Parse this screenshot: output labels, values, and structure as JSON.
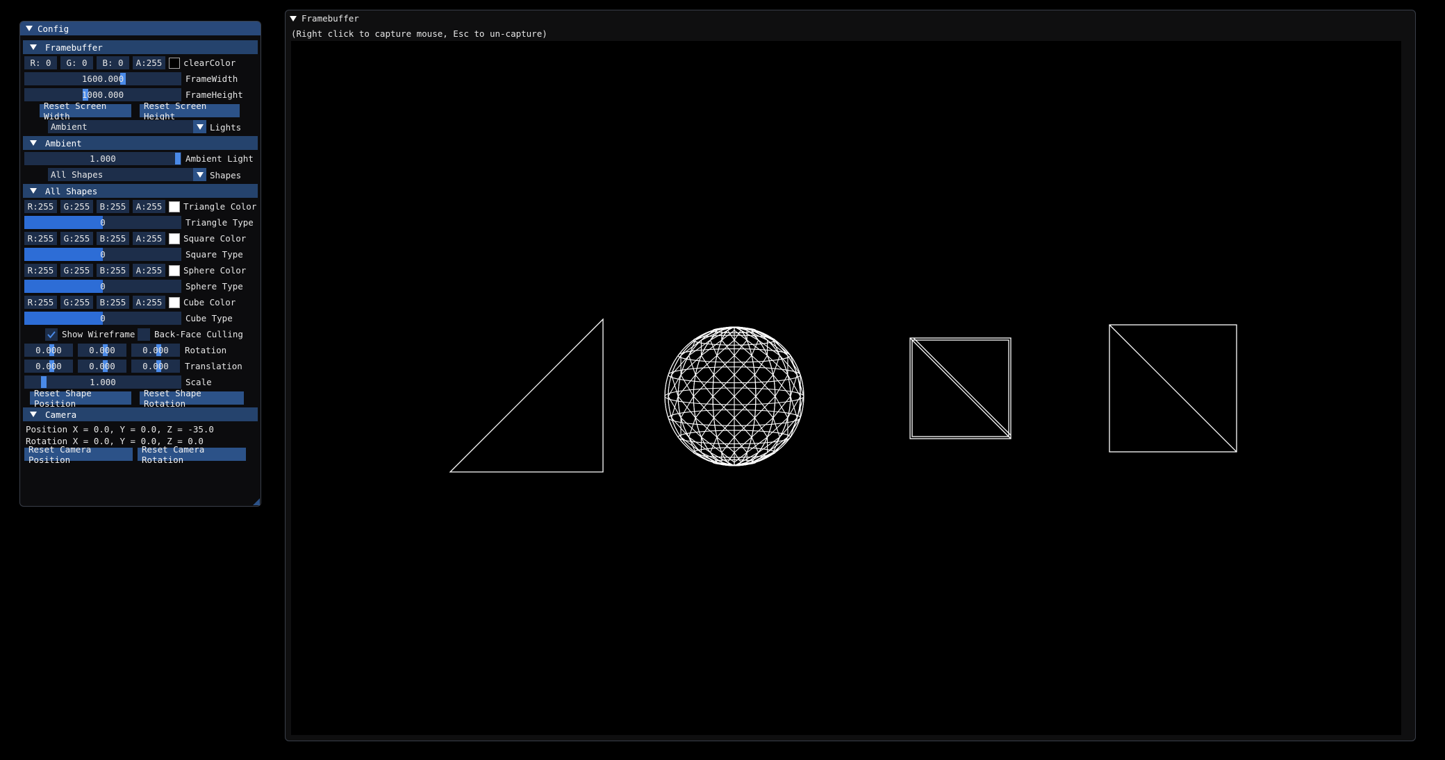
{
  "config": {
    "title": "Config",
    "framebuffer_header": "Framebuffer",
    "clear_color": {
      "r": "R:  0",
      "g": "G:  0",
      "b": "B:  0",
      "a": "A:255",
      "label": "clearColor",
      "swatch": "#000000"
    },
    "frame_width": {
      "value": "1600.000",
      "label": "FrameWidth"
    },
    "frame_height": {
      "value": "1000.000",
      "label": "FrameHeight"
    },
    "reset_width": "Reset Screen Width",
    "reset_height": "Reset Screen Height",
    "lights_combo": {
      "value": "Ambient",
      "label": "Lights"
    },
    "ambient_header": "Ambient",
    "ambient_light": {
      "value": "1.000",
      "label": "Ambient Light"
    },
    "shapes_combo": {
      "value": "All Shapes",
      "label": "Shapes"
    },
    "all_shapes_header": "All Shapes",
    "shapes": [
      {
        "color_label": "Triangle Color",
        "type_label": "Triangle Type",
        "type_value": "0"
      },
      {
        "color_label": "Square Color",
        "type_label": "Square Type",
        "type_value": "0"
      },
      {
        "color_label": "Sphere Color",
        "type_label": "Sphere Type",
        "type_value": "0"
      },
      {
        "color_label": "Cube Color",
        "type_label": "Cube Type",
        "type_value": "0"
      }
    ],
    "rgba": {
      "r": "R:255",
      "g": "G:255",
      "b": "B:255",
      "a": "A:255",
      "swatch": "#ffffff"
    },
    "show_wireframe": {
      "label": "Show Wireframe",
      "checked": true
    },
    "backface": {
      "label": "Back-Face Culling",
      "checked": false
    },
    "rotation": {
      "x": "0.000",
      "y": "0.000",
      "z": "0.000",
      "label": "Rotation"
    },
    "translation": {
      "x": "0.000",
      "y": "0.000",
      "z": "0.000",
      "label": "Translation"
    },
    "scale": {
      "value": "1.000",
      "label": "Scale"
    },
    "reset_shape_position": "Reset Shape Position",
    "reset_shape_rotation": "Reset Shape Rotation",
    "camera_header": "Camera",
    "camera_position": "Position X = 0.0, Y = 0.0, Z = -35.0",
    "camera_rotation": "Rotation X = 0.0, Y = 0.0, Z = 0.0",
    "reset_camera_position": "Reset Camera Position",
    "reset_camera_rotation": "Reset Camera Rotation"
  },
  "framebuffer": {
    "title": "Framebuffer",
    "hint": "(Right click to capture mouse, Esc to un-capture)"
  }
}
